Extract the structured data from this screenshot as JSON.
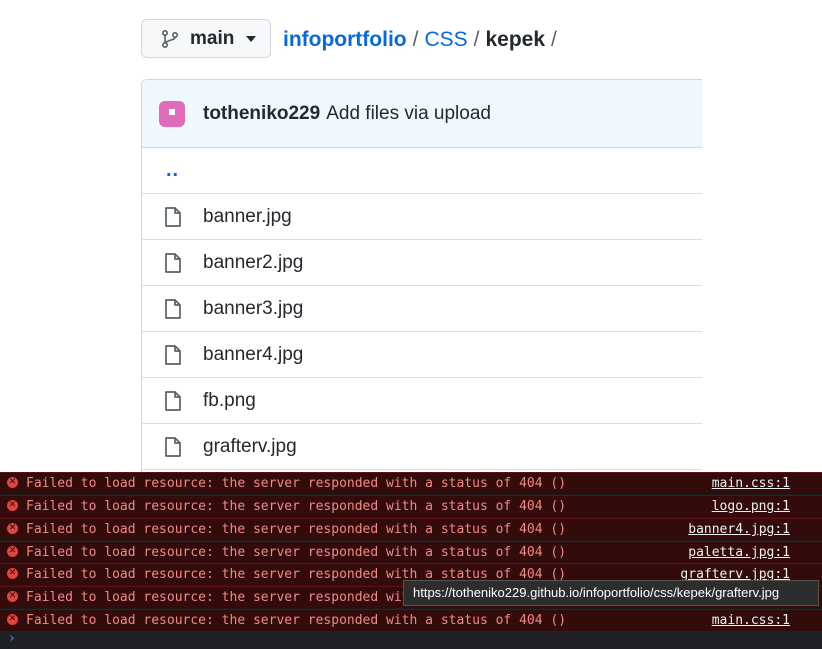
{
  "branch": {
    "label": "main"
  },
  "breadcrumb": {
    "repo": "infoportfolio",
    "folder": "CSS",
    "current": "kepek",
    "sep": "/"
  },
  "commit": {
    "author": "totheniko229",
    "message": "Add files via upload"
  },
  "files": {
    "up": "..",
    "items": [
      "banner.jpg",
      "banner2.jpg",
      "banner3.jpg",
      "banner4.jpg",
      "fb.png",
      "grafterv.jpg"
    ]
  },
  "console": {
    "messages": [
      {
        "text": "Failed to load resource: the server responded with a status of 404 ()",
        "source": "main.css:1"
      },
      {
        "text": "Failed to load resource: the server responded with a status of 404 ()",
        "source": "logo.png:1"
      },
      {
        "text": "Failed to load resource: the server responded with a status of 404 ()",
        "source": "banner4.jpg:1"
      },
      {
        "text": "Failed to load resource: the server responded with a status of 404 ()",
        "source": "paletta.jpg:1"
      },
      {
        "text": "Failed to load resource: the server responded with a status of 404 ()",
        "source": "grafterv.jpg:1"
      },
      {
        "text": "Failed to load resource: the server responded with",
        "source": ""
      },
      {
        "text": "Failed to load resource: the server responded with a status of 404 ()",
        "source": "main.css:1"
      }
    ],
    "prompt": "›",
    "tooltip": "https://totheniko229.github.io/infoportfolio/css/kepek/grafterv.jpg"
  }
}
